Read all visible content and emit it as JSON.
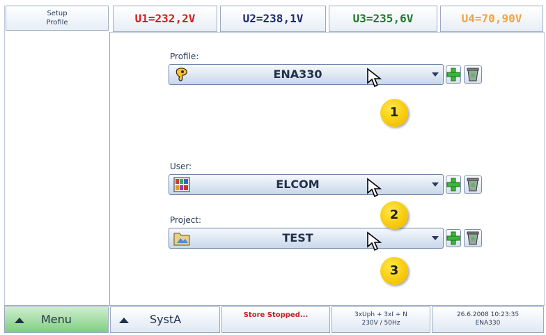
{
  "header": {
    "title_line1": "Setup",
    "title_line2": "Profile",
    "voltages": [
      {
        "label": "U1=232,2V",
        "color": "#d61a1a"
      },
      {
        "label": "U2=238,1V",
        "color": "#1e2a6e"
      },
      {
        "label": "U3=235,6V",
        "color": "#1f7a2a"
      },
      {
        "label": "U4=70,90V",
        "color": "#f4a340"
      }
    ]
  },
  "fields": {
    "profile": {
      "label": "Profile:",
      "value": "ENA330",
      "icon": "profile-icon"
    },
    "user": {
      "label": "User:",
      "value": "ELCOM",
      "icon": "users-icon"
    },
    "project": {
      "label": "Project:",
      "value": "TEST",
      "icon": "folder-icon"
    }
  },
  "markers": [
    "1",
    "2",
    "3"
  ],
  "bottom_bar": {
    "menu_label": "Menu",
    "syst_label": "SystA",
    "store_status": "Store Stopped...",
    "mode_line1": "3xUph + 3xI + N",
    "mode_line2": "230V / 50Hz",
    "datetime": "26.6.2008 10:23:35",
    "device": "ENA330"
  }
}
